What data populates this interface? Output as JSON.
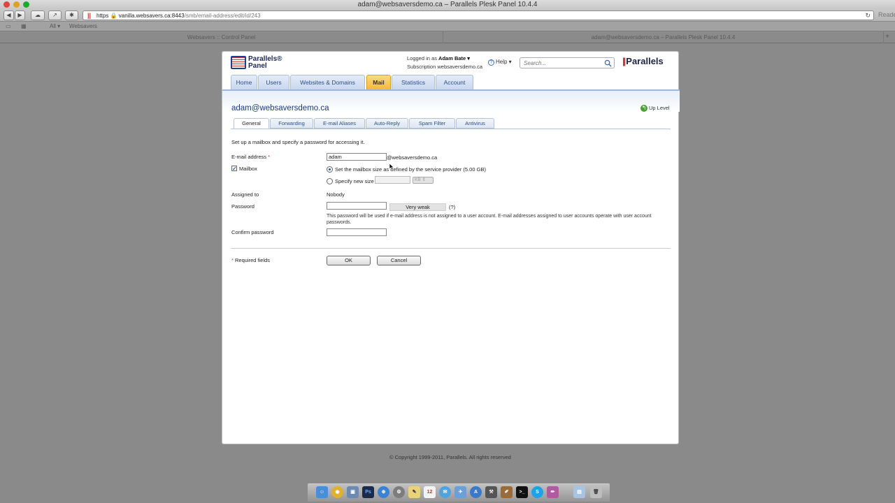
{
  "window": {
    "title": "adam@websaversdemo.ca – Parallels Plesk Panel 10.4.4",
    "reader_label": "Reade"
  },
  "browser": {
    "url_scheme": "https",
    "url_host": "vanilla.websavers.ca:8443",
    "url_path": "/smb/email-address/edit/id/243",
    "bookmarks": [
      "All ▾",
      "Websavers"
    ],
    "tabs": [
      "Websavers :: Control Panel",
      "adam@websaversdemo.ca – Parallels Plesk Panel 10.4.4"
    ]
  },
  "header": {
    "logo_line1": "Parallels®",
    "logo_line2": "Panel",
    "logged_in_prefix": "Logged in as",
    "logged_in_user": "Adam Bate ▾",
    "subscription_prefix": "Subscription",
    "subscription_value": "websaversdemo.ca",
    "help_label": "Help ▾",
    "search_placeholder": "Search...",
    "brand": "Parallels"
  },
  "nav": {
    "tabs": [
      "Home",
      "Users",
      "Websites & Domains",
      "Mail",
      "Statistics",
      "Account"
    ],
    "active": "Mail"
  },
  "page": {
    "title": "adam@websaversdemo.ca",
    "up_level": "Up Level",
    "subtabs": [
      "General",
      "Forwarding",
      "E-mail Aliases",
      "Auto-Reply",
      "Spam Filter",
      "Antivirus"
    ],
    "active_subtab": "General",
    "intro": "Set up a mailbox and specify a password for accessing it."
  },
  "form": {
    "email_label": "E-mail address",
    "email_value": "adam",
    "email_domain": "@websaversdemo.ca",
    "mailbox_label": "Mailbox",
    "mailbox_checked": true,
    "size_option_default": "Set the mailbox size as defined by the service provider (5.00 GB)",
    "size_option_custom": "Specify new size",
    "size_unit": "KB",
    "assigned_label": "Assigned to",
    "assigned_value": "Nobody",
    "password_label": "Password",
    "password_strength": "Very weak",
    "password_help": "(?)",
    "password_hint": "This password will be used if e-mail address is not assigned to a user account. E-mail addresses assigned to user accounts operate with user account passwords.",
    "confirm_label": "Confirm password",
    "required_note": "Required fields",
    "ok_label": "OK",
    "cancel_label": "Cancel"
  },
  "footer": {
    "copyright": "© Copyright 1999-2011, Parallels. All rights reserved"
  },
  "colors": {
    "active_tab": "#f4b93a",
    "link_blue": "#2c4f8a",
    "title_blue": "#1d3c78",
    "required_red": "#c0392b"
  }
}
